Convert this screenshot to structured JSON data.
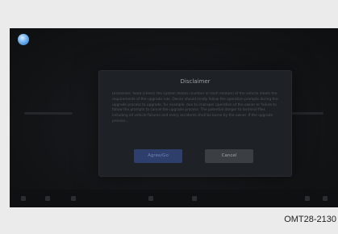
{
  "screen": {
    "background_title": "SMART FOLK"
  },
  "dialog": {
    "title": "Disclaimer",
    "body": "Disclaimer: Read (check) the system details (number of each module) of the vehicle meets the requirements of the upgrade rule. Owner should kindly follow the operation prompts during the upgrade process to upgrade, for example, due to improper operation of the owner or failure to follow the prompts to cancel the upgrade process. The potential danger to terminal files including all vehicle failures and every accidents shall be borne by the owner. If the upgrade process...",
    "agree_label": "Agree/Go",
    "cancel_label": "Cancel"
  },
  "caption": "OMT28-2130",
  "colors": {
    "agree_button": "#2e3f6b",
    "cancel_button": "#3b3f44",
    "dialog_bg": "#1e2226",
    "screen_bg": "#101214"
  },
  "icons": [
    "app-logo-icon",
    "dock-icons"
  ]
}
